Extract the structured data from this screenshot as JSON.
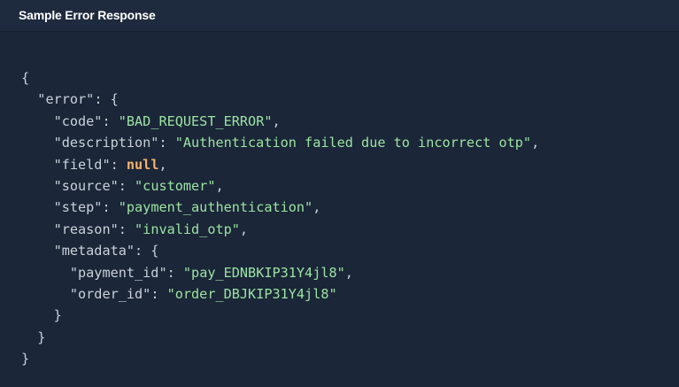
{
  "header": {
    "title": "Sample Error Response"
  },
  "code": {
    "open_brace": "{",
    "error_key": "\"error\"",
    "error_open": ": {",
    "fields": [
      {
        "key": "\"code\"",
        "value": "\"BAD_REQUEST_ERROR\"",
        "type": "string"
      },
      {
        "key": "\"description\"",
        "value": "\"Authentication failed due to incorrect otp\"",
        "type": "string"
      },
      {
        "key": "\"field\"",
        "value": "null",
        "type": "literal"
      },
      {
        "key": "\"source\"",
        "value": "\"customer\"",
        "type": "string"
      },
      {
        "key": "\"step\"",
        "value": "\"payment_authentication\"",
        "type": "string"
      },
      {
        "key": "\"reason\"",
        "value": "\"invalid_otp\"",
        "type": "string"
      }
    ],
    "metadata_key": "\"metadata\"",
    "metadata_open": ": {",
    "metadata_fields": [
      {
        "key": "\"payment_id\"",
        "value": "\"pay_EDNBKIP31Y4jl8\"",
        "type": "string"
      },
      {
        "key": "\"order_id\"",
        "value": "\"order_DBJKIP31Y4jl8\"",
        "type": "string"
      }
    ],
    "metadata_close": "}",
    "error_close": "}",
    "close_brace": "}"
  },
  "colors": {
    "background": "#1b2638",
    "header_background": "#1e2a3d",
    "key_text": "#c9d1d9",
    "string_value": "#9be3a2",
    "literal_value": "#f6b26b"
  }
}
